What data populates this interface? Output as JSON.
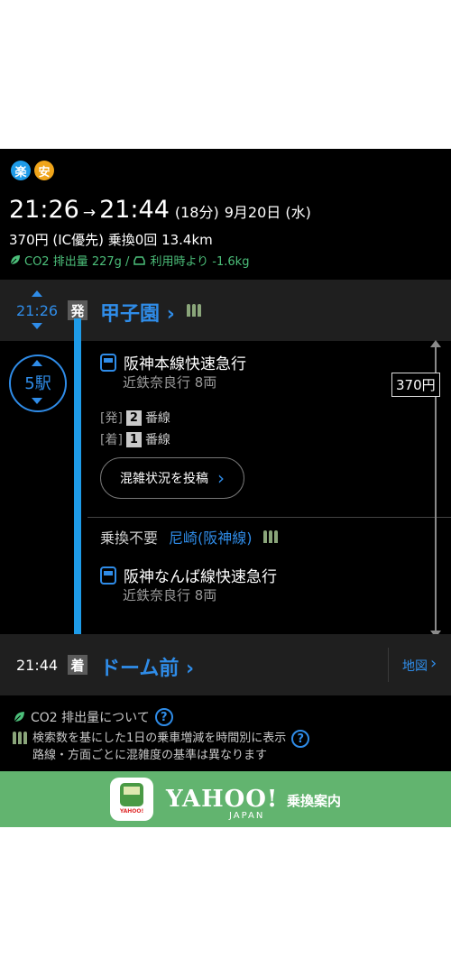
{
  "colors": {
    "accent": "#2f8ce8",
    "line": "#1e9be8",
    "eco": "#4cbf7a",
    "banner": "#62b46f"
  },
  "badges": [
    "楽",
    "安"
  ],
  "summary": {
    "depart_time": "21:26",
    "arrow": "→",
    "arrive_time": "21:44",
    "duration": "(18分)",
    "date": "9月20日 (水)",
    "fare_line": "370円 (IC優先) 乗換0回 13.4km",
    "co2": "CO2 排出量 227g /",
    "car_compare": "利用時より -1.6kg"
  },
  "departure": {
    "time": "21:26",
    "kanji": "発",
    "station": "甲子園",
    "chevron": "›"
  },
  "stops": {
    "count": "5駅"
  },
  "train1": {
    "name": "阪神本線快速急行",
    "sub": "近鉄奈良行  8両"
  },
  "platforms": [
    {
      "label": "[発]",
      "num": "2",
      "suffix": "番線"
    },
    {
      "label": "[着]",
      "num": "1",
      "suffix": "番線"
    }
  ],
  "post_button": {
    "label": "混雑状況を投稿",
    "chevron": "›"
  },
  "transfer": {
    "label": "乗換不要",
    "station": "尼崎(阪神線)"
  },
  "train2": {
    "name": "阪神なんば線快速急行",
    "sub": "近鉄奈良行  8両"
  },
  "fare": "370円",
  "arrival": {
    "time": "21:44",
    "kanji": "着",
    "station": "ドーム前",
    "chevron": "›",
    "map": "地図",
    "map_chevron": "›"
  },
  "footer": {
    "co2_about": "CO2 排出量について",
    "q": "?",
    "crowd_line1": "検索数を基にした1日の乗車増減を時間別に表示",
    "crowd_line2": "路線・方面ごとに混雑度の基準は異なります"
  },
  "banner": {
    "icon_text": "YAHOO!",
    "logo": "YAHOO!",
    "japan": "JAPAN",
    "service": "乗換案内"
  }
}
